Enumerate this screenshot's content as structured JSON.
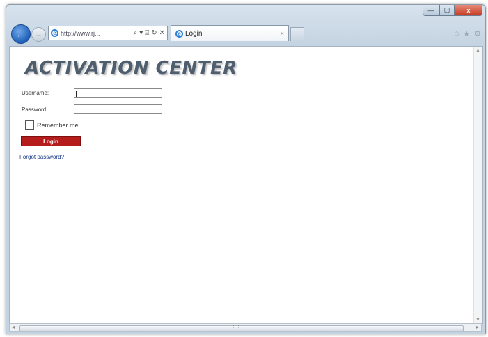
{
  "browser": {
    "address_url": "http://www.rj...",
    "address_icons": [
      "⌕",
      "▾",
      "⌸",
      "↻",
      "✕"
    ],
    "tab_title": "Login",
    "tab_close": "×",
    "back_glyph": "←",
    "forward_glyph": "→",
    "right_icons": [
      "⌂",
      "★",
      "⚙"
    ],
    "window_controls": {
      "minimize": "—",
      "maximize": "▢",
      "close": "x"
    }
  },
  "page": {
    "heading": "ACTIVATION CENTER",
    "username_label": "Username:",
    "username_value": "",
    "password_label": "Password:",
    "password_value": "",
    "remember_label": "Remember me",
    "remember_checked": false,
    "login_button": "Login",
    "forgot_link": "Forgot password?"
  },
  "colors": {
    "login_button": "#b51c1c",
    "link": "#1a3a8a",
    "heading": "#4f5e6e"
  }
}
